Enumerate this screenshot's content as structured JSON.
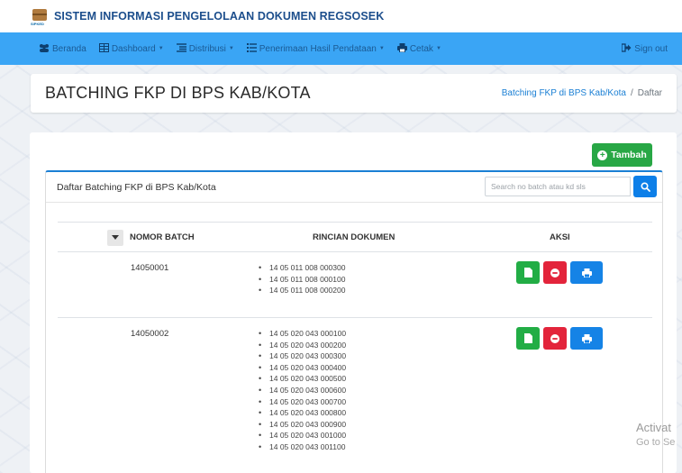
{
  "app": {
    "title": "SISTEM INFORMASI PENGELOLAAN DOKUMEN REGSOSEK",
    "logo_text": "SIPKED"
  },
  "navbar": {
    "items": [
      {
        "label": "Beranda",
        "icon": "groups-icon",
        "has_caret": false
      },
      {
        "label": "Dashboard",
        "icon": "table-icon",
        "has_caret": true
      },
      {
        "label": "Distribusi",
        "icon": "list-icon",
        "has_caret": true
      },
      {
        "label": "Penerimaan Hasil Pendataan",
        "icon": "list-icon",
        "has_caret": true
      },
      {
        "label": "Cetak",
        "icon": "print-icon",
        "has_caret": true
      }
    ],
    "signout_label": "Sign out"
  },
  "header": {
    "page_title": "BATCHING FKP DI BPS KAB/KOTA",
    "breadcrumb": {
      "link": "Batching FKP di BPS Kab/Kota",
      "separator": "/",
      "current": "Daftar"
    }
  },
  "toolbar": {
    "add_label": "Tambah"
  },
  "list": {
    "title": "Daftar Batching FKP di BPS Kab/Kota",
    "search_placeholder": "Search no batch atau kd sls",
    "columns": {
      "batch": "NOMOR BATCH",
      "docs": "RINCIAN DOKUMEN",
      "actions": "AKSI"
    },
    "rows": [
      {
        "batch": "14050001",
        "docs": [
          "14 05 011 008 000300",
          "14 05 011 008 000100",
          "14 05 011 008 000200"
        ]
      },
      {
        "batch": "14050002",
        "docs": [
          "14 05 020 043 000100",
          "14 05 020 043 000200",
          "14 05 020 043 000300",
          "14 05 020 043 000400",
          "14 05 020 043 000500",
          "14 05 020 043 000600",
          "14 05 020 043 000700",
          "14 05 020 043 000800",
          "14 05 020 043 000900",
          "14 05 020 043 001000",
          "14 05 020 043 001100"
        ]
      }
    ]
  },
  "watermark": {
    "line1": "Activat",
    "line2": "Go to Se"
  },
  "colors": {
    "navbar": "#3aa5f5",
    "brand_title": "#1c4e8c",
    "accent_blue": "#1a7fd4",
    "green": "#28a745",
    "red": "#e3243b"
  }
}
